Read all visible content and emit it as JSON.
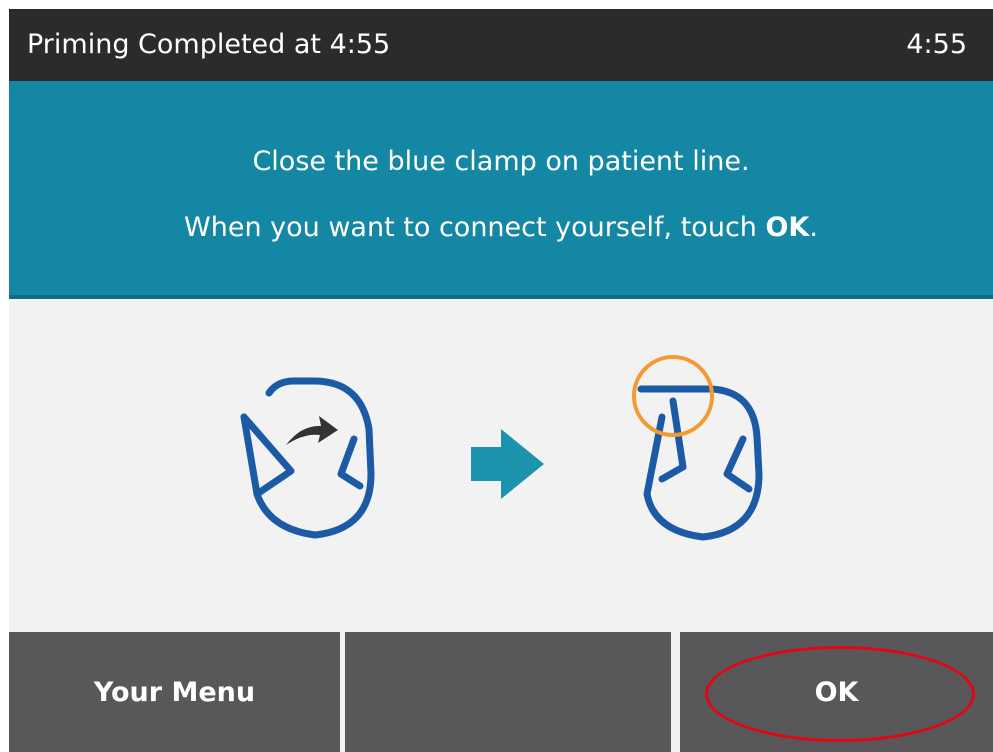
{
  "status_bar": {
    "title": "Priming Completed at 4:55",
    "time": "4:55"
  },
  "instruction": {
    "line1": "Close the blue clamp on patient line.",
    "line2_prefix": "When you want to connect yourself, touch ",
    "line2_emphasis": "OK",
    "line2_suffix": "."
  },
  "illustration": {
    "open_clamp_icon": "clamp-open-icon",
    "arrow_icon": "arrow-right-icon",
    "closed_clamp_icon": "clamp-closed-icon",
    "clamp_color": "#1d5aa6",
    "arrow_color": "#1e93ad",
    "highlight_color": "#f39b2f"
  },
  "footer": {
    "left_label": "Your Menu",
    "middle_label": "",
    "right_label": "OK"
  },
  "colors": {
    "status_bar": "#2b2b2b",
    "banner": "#1387a3",
    "button": "#58585b",
    "ok_highlight": "#e30613"
  }
}
